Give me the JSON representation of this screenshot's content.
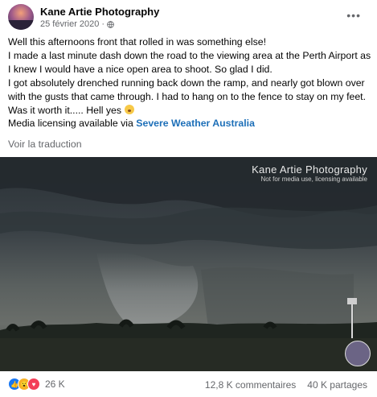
{
  "post": {
    "page_name": "Kane Artie Photography",
    "date": "25 février 2020",
    "separator": "·",
    "lines": [
      "Well this afternoons front that rolled in was something else!",
      "I made a last minute dash down the road to the viewing area at the Perth Airport as I knew I would have a nice open area to shoot. So glad I did.",
      "I got absolutely drenched running back down the ramp, and nearly got blown over with the gusts that came through. I had to hang on to the fence to stay on my feet.",
      "Was it worth it..... Hell yes"
    ],
    "licensing_prefix": "Media licensing available via",
    "licensing_link": "Severe Weather Australia",
    "translate": "Voir la traduction"
  },
  "photo": {
    "watermark_title": "Kane Artie Photography",
    "watermark_sub": "Not for media use, licensing available"
  },
  "footer": {
    "reaction_count": "26 K",
    "comments": "12,8 K commentaires",
    "shares": "40 K partages"
  },
  "colors": {
    "link": "#1d6fb8",
    "muted": "#65676b",
    "like": "#1877f2",
    "wow": "#f7b125",
    "love": "#f33e58"
  }
}
